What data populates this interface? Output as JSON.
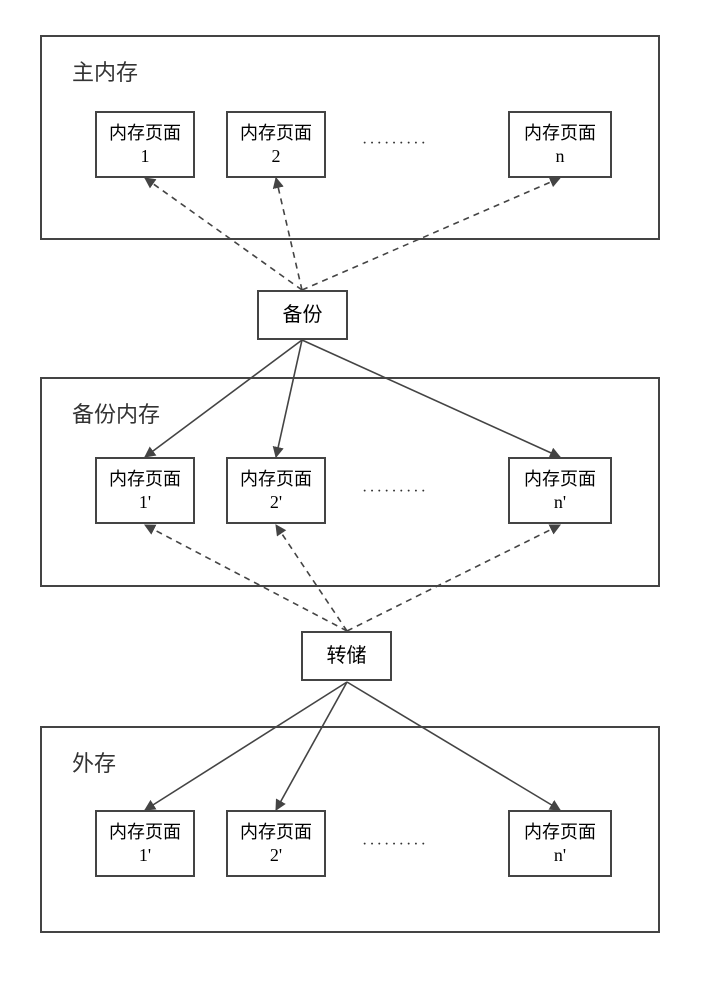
{
  "regions": {
    "main": {
      "title": "主内存"
    },
    "backup": {
      "title": "备份内存"
    },
    "external": {
      "title": "外存"
    }
  },
  "ops": {
    "backup": "备份",
    "dump": "转储"
  },
  "pages": {
    "main": [
      "内存页面\n1",
      "内存页面\n2",
      "内存页面\nn"
    ],
    "backup_copy": [
      "内存页面\n1'",
      "内存页面\n2'",
      "内存页面\nn'"
    ],
    "external": [
      "内存页面\n1'",
      "内存页面\n2'",
      "内存页面\nn'"
    ]
  },
  "ellipsis": "·········"
}
